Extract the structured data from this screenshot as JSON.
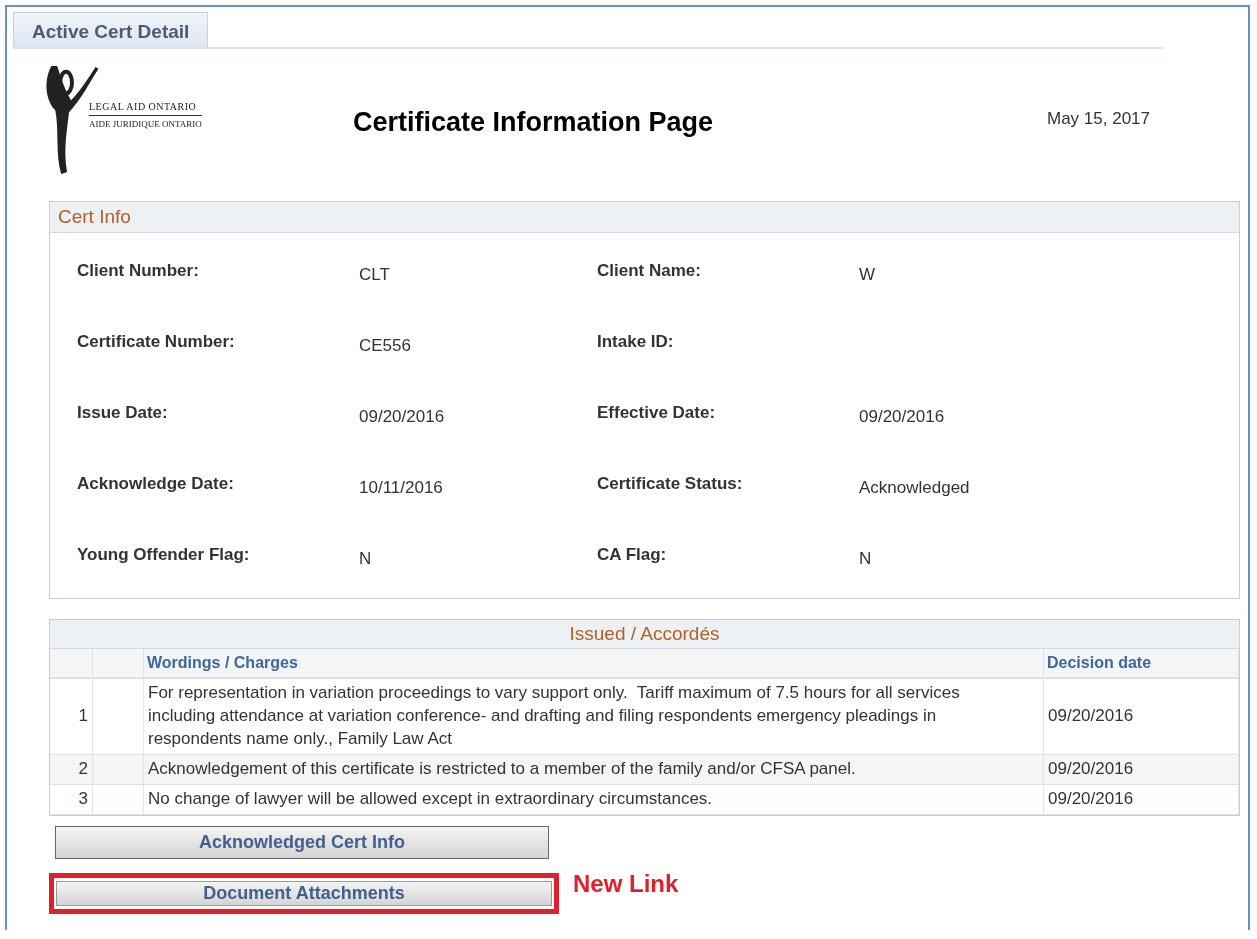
{
  "tab": {
    "label": "Active Cert Detail",
    "selected": true
  },
  "logo": {
    "line_1": "LEGAL AID ONTARIO",
    "line_2": "AIDE JURIDIQUE ONTARIO"
  },
  "title": "Certificate Information Page",
  "date": "May 15, 2017",
  "cert_info": {
    "heading": "Cert Info",
    "fields": [
      {
        "label": "Client Number:",
        "value": "CLT"
      },
      {
        "label": "Client Name:",
        "value": "W"
      },
      {
        "label": "Certificate Number:",
        "value": "CE556"
      },
      {
        "label": "Intake ID:"
      },
      {
        "label": "Issue Date:",
        "value": "09/20/2016"
      },
      {
        "label": "Effective Date:",
        "value": "09/20/2016"
      },
      {
        "label": "Acknowledge Date:",
        "value": "10/11/2016"
      },
      {
        "label": "Certificate Status:",
        "value": "Acknowledged"
      },
      {
        "label": "Young Offender Flag:",
        "value": "N"
      },
      {
        "label": "CA Flag:",
        "value": "N"
      }
    ]
  },
  "issued": {
    "heading": "Issued / Accordés",
    "columns": [
      "Wordings / Charges",
      "Decision date"
    ],
    "rows": [
      {
        "number": "1",
        "wording": "For representation in variation proceedings to vary support only.  Tariff maximum of 7.5 hours for all services including attendance at variation conference- and drafting and filing respondents emergency pleadings in respondents name only., Family Law Act",
        "date": "09/20/2016"
      },
      {
        "number": "2",
        "wording": "Acknowledgement of this certificate is restricted to a member of the family and/or CFSA panel.",
        "date": "09/20/2016"
      },
      {
        "number": "3",
        "wording": "No change of lawyer will be allowed except in extraordinary circumstances.",
        "date": "09/20/2016"
      }
    ]
  },
  "buttons": [
    {
      "label": "Acknowledged Cert Info",
      "highlighted": false
    },
    {
      "label": "Document Attachments",
      "highlighted": true
    }
  ],
  "annotation": "New Link"
}
